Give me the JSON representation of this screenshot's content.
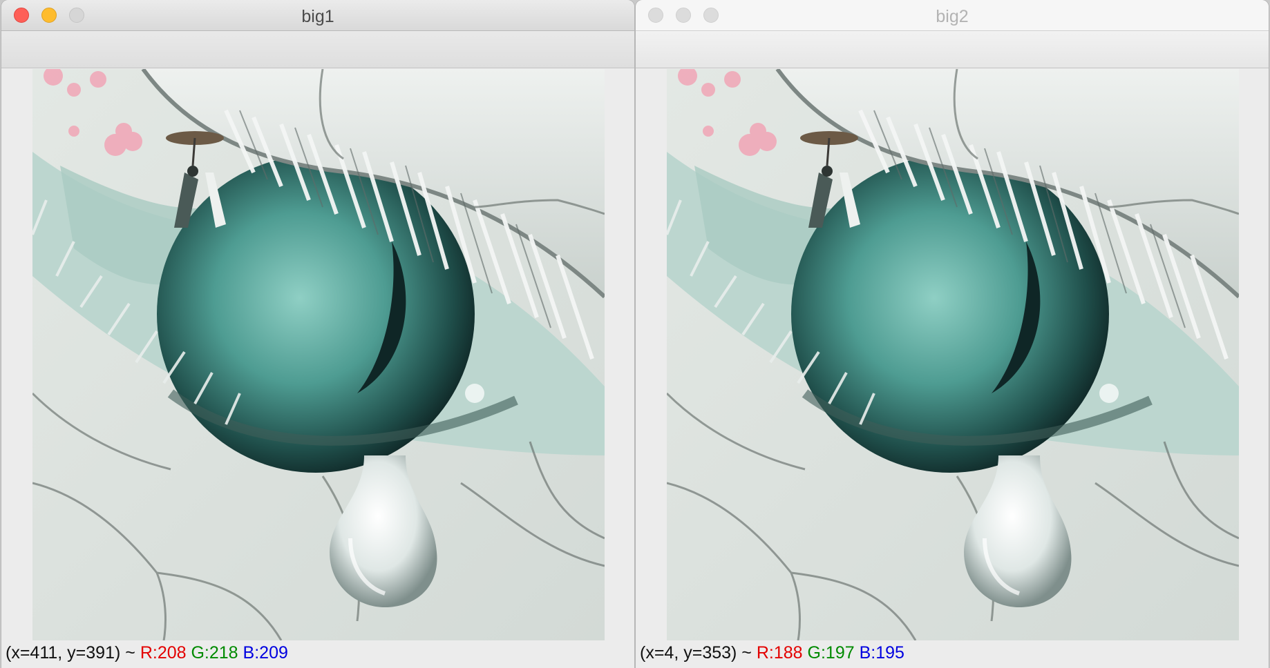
{
  "windows": [
    {
      "title": "big1",
      "status": {
        "coords": "(x=411, y=391) ~",
        "r": "R:208",
        "g": "G:218",
        "b": "B:209"
      }
    },
    {
      "title": "big2",
      "status": {
        "coords": "(x=4, y=353) ~",
        "r": "R:188",
        "g": "G:197",
        "b": "B:195"
      }
    }
  ],
  "image": {
    "subject": "teary-eye-painting"
  },
  "colors": {
    "close": "#fe5f57",
    "minimize": "#febc2e",
    "red": "#e30000",
    "green": "#008a00",
    "blue": "#0000e0"
  }
}
